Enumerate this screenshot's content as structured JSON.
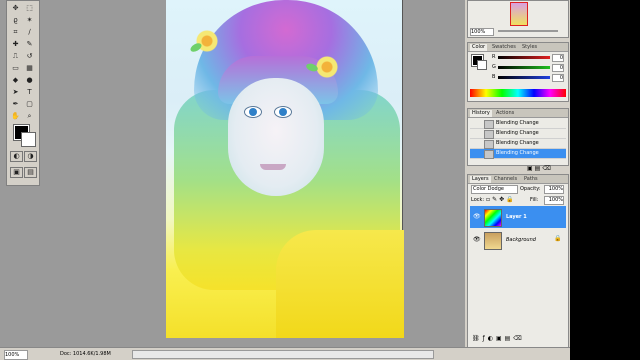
{
  "navigator": {
    "zoom": "100%"
  },
  "color_panel": {
    "tabs": [
      "Color",
      "Swatches",
      "Styles"
    ],
    "channels": [
      {
        "label": "R",
        "value": "0",
        "color": "#d02020"
      },
      {
        "label": "G",
        "value": "0",
        "color": "#20a020"
      },
      {
        "label": "B",
        "value": "0",
        "color": "#2040d0"
      }
    ]
  },
  "history_panel": {
    "tabs": [
      "History",
      "Actions"
    ],
    "items": [
      "Blending Change",
      "Blending Change",
      "Blending Change",
      "Blending Change"
    ],
    "selected_index": 3
  },
  "layers_panel": {
    "tabs": [
      "Layers",
      "Channels",
      "Paths"
    ],
    "blend_mode": "Color Dodge",
    "opacity_label": "Opacity:",
    "opacity_value": "100%",
    "lock_label": "Lock:",
    "fill_label": "Fill:",
    "fill_value": "100%",
    "layers": [
      {
        "name": "Layer 1",
        "selected": true
      },
      {
        "name": "Background",
        "selected": false
      }
    ]
  },
  "status_bar": {
    "zoom": "100%",
    "doc": "Doc: 1014.6K/1.98M"
  },
  "icons": [
    "move-icon",
    "marquee-icon",
    "lasso-icon",
    "crop-icon",
    "brush-icon",
    "stamp-icon",
    "eraser-icon",
    "gradient-icon",
    "pen-icon",
    "type-icon",
    "hand-icon",
    "zoom-icon",
    "eye-icon",
    "lock-icon"
  ],
  "colors": {
    "selection": "#3b8ff0",
    "accent_highlight": "#1d7de6"
  }
}
